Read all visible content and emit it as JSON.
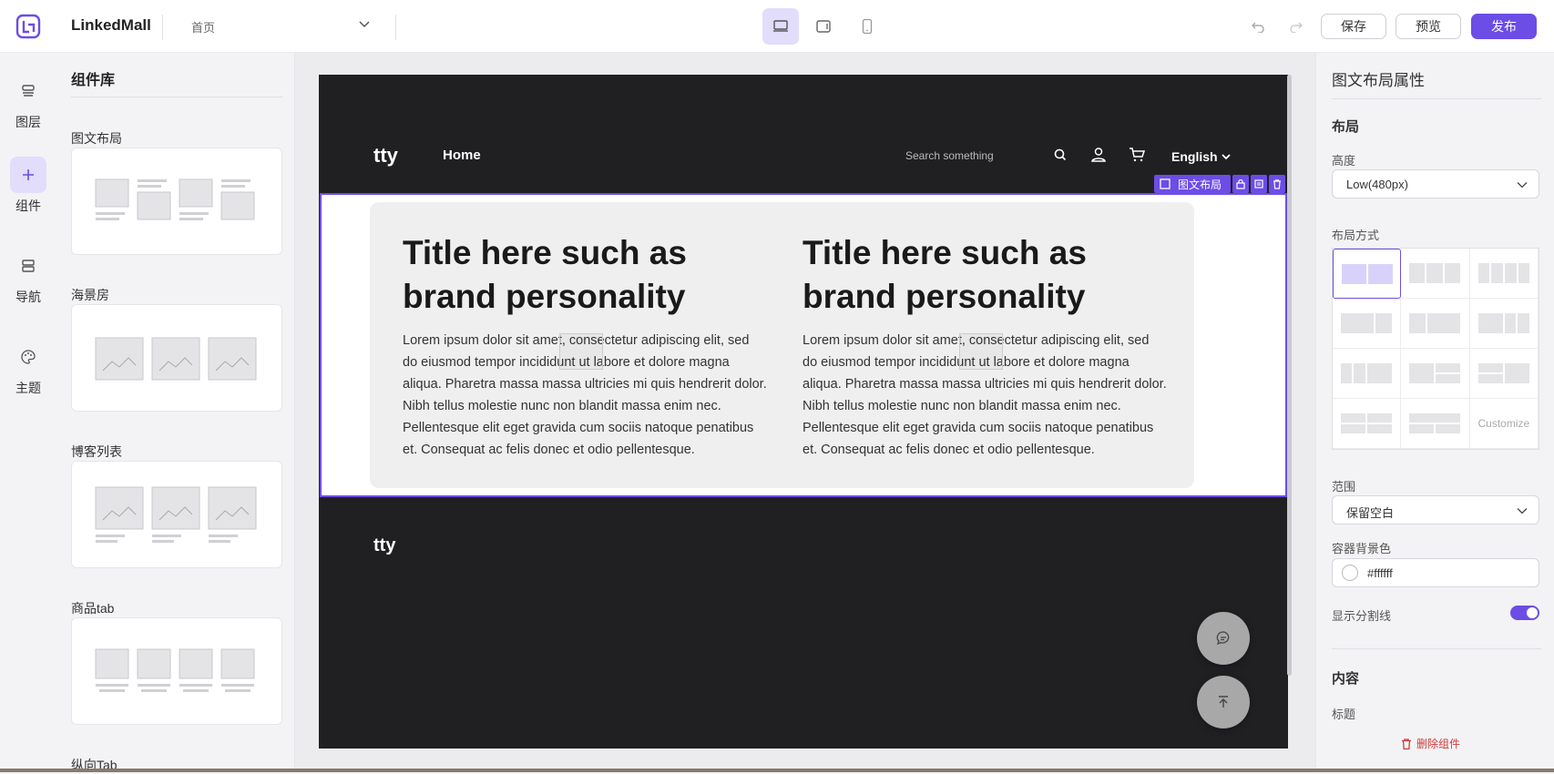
{
  "app": {
    "brand": "LinkedMall",
    "page": "首页"
  },
  "toolbar": {
    "save": "保存",
    "preview": "预览",
    "publish": "发布"
  },
  "rail": [
    {
      "icon": "layers-icon",
      "label": "图层"
    },
    {
      "icon": "plus-icon",
      "label": "组件",
      "active": true
    },
    {
      "icon": "nav-icon",
      "label": "导航"
    },
    {
      "icon": "palette-icon",
      "label": "主题"
    }
  ],
  "library": {
    "title": "组件库",
    "sections": [
      "图文布局",
      "海景房",
      "博客列表",
      "商品tab",
      "纵向Tab"
    ]
  },
  "site": {
    "logo": "tty",
    "nav": "Home",
    "search_placeholder": "Search something",
    "language": "English",
    "footer_logo": "tty"
  },
  "selection": {
    "label": "图文布局"
  },
  "cards": [
    {
      "title": "Title here such as brand personality",
      "body": "Lorem ipsum dolor sit amet, consectetur adipiscing elit, sed do eiusmod tempor incididunt ut labore et dolore magna aliqua. Pharetra massa massa ultricies mi quis hendrerit dolor. Nibh tellus molestie nunc non blandit massa enim nec. Pellentesque elit eget gravida cum sociis natoque penatibus et. Consequat ac felis donec et odio pellentesque."
    },
    {
      "title": "Title here such as brand personality",
      "body": "Lorem ipsum dolor sit amet, consectetur adipiscing elit, sed do eiusmod tempor incididunt ut labore et dolore magna aliqua. Pharetra massa massa ultricies mi quis hendrerit dolor. Nibh tellus molestie nunc non blandit massa enim nec. Pellentesque elit eget gravida cum sociis natoque penatibus et. Consequat ac felis donec et odio pellentesque."
    }
  ],
  "props": {
    "title": "图文布局属性",
    "layout_section": "布局",
    "height_label": "高度",
    "height_value": "Low(480px)",
    "layout_mode_label": "布局方式",
    "customize": "Customize",
    "range_label": "范围",
    "range_value": "保留空白",
    "bg_label": "容器背景色",
    "bg_value": "#ffffff",
    "divider_label": "显示分割线",
    "divider_on": true,
    "content_section": "内容",
    "title_label": "标题",
    "delete": "删除组件"
  },
  "colors": {
    "accent": "#6c4de6",
    "canvas": "#202023"
  }
}
